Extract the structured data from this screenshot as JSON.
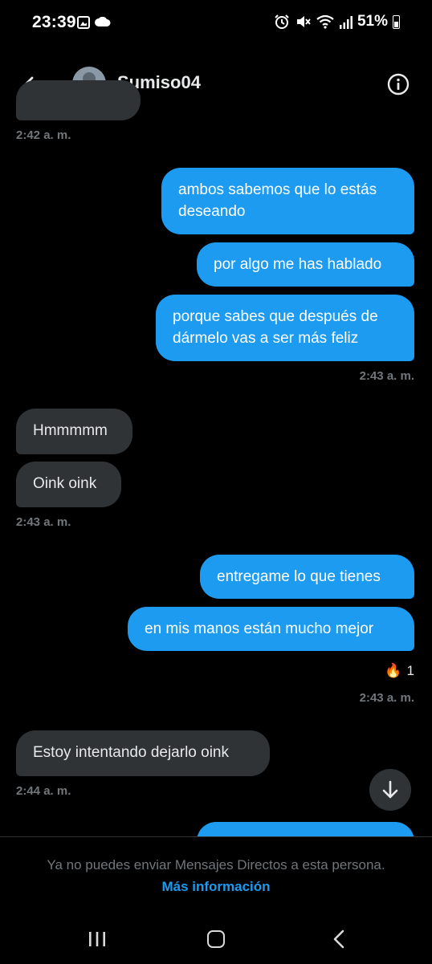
{
  "status_bar": {
    "time": "23:39",
    "battery": "51%",
    "icons": [
      "gallery-icon",
      "cloud-icon",
      "alarm-icon",
      "mute-icon",
      "wifi-icon",
      "signal-icon",
      "battery-icon"
    ]
  },
  "header": {
    "username": "Sumiso04",
    "icons": [
      "back-arrow-icon",
      "avatar",
      "info-icon"
    ]
  },
  "messages": [
    {
      "side": "in",
      "time": "2:42 a. m."
    },
    {
      "side": "out",
      "lines": [
        "ambos sabemos que lo estás",
        "deseando"
      ]
    },
    {
      "side": "out",
      "text": "por algo me has hablado"
    },
    {
      "side": "out",
      "lines": [
        "porque sabes que después de",
        "dármelo vas a ser más feliz"
      ],
      "time": "2:43 a. m."
    },
    {
      "side": "in",
      "text": "Hmmmmm"
    },
    {
      "side": "in",
      "text": "Oink oink",
      "time": "2:43 a. m."
    },
    {
      "side": "out",
      "text": "entregame lo que tienes"
    },
    {
      "side": "out",
      "text": "en mis manos están mucho mejor",
      "reaction": {
        "emoji": "🔥",
        "count": "1"
      },
      "time": "2:43 a. m."
    },
    {
      "side": "in",
      "text": "Estoy intentando dejarlo oink",
      "time": "2:44 a. m."
    }
  ],
  "footer": {
    "message": "Ya no puedes enviar Mensajes Directos a esta persona.",
    "link": "Más información"
  },
  "colors": {
    "background": "#000000",
    "incoming_bubble": "#2f3336",
    "outgoing_bubble": "#1d9bf0",
    "timestamp": "#71767b",
    "link": "#1d9bf0"
  }
}
